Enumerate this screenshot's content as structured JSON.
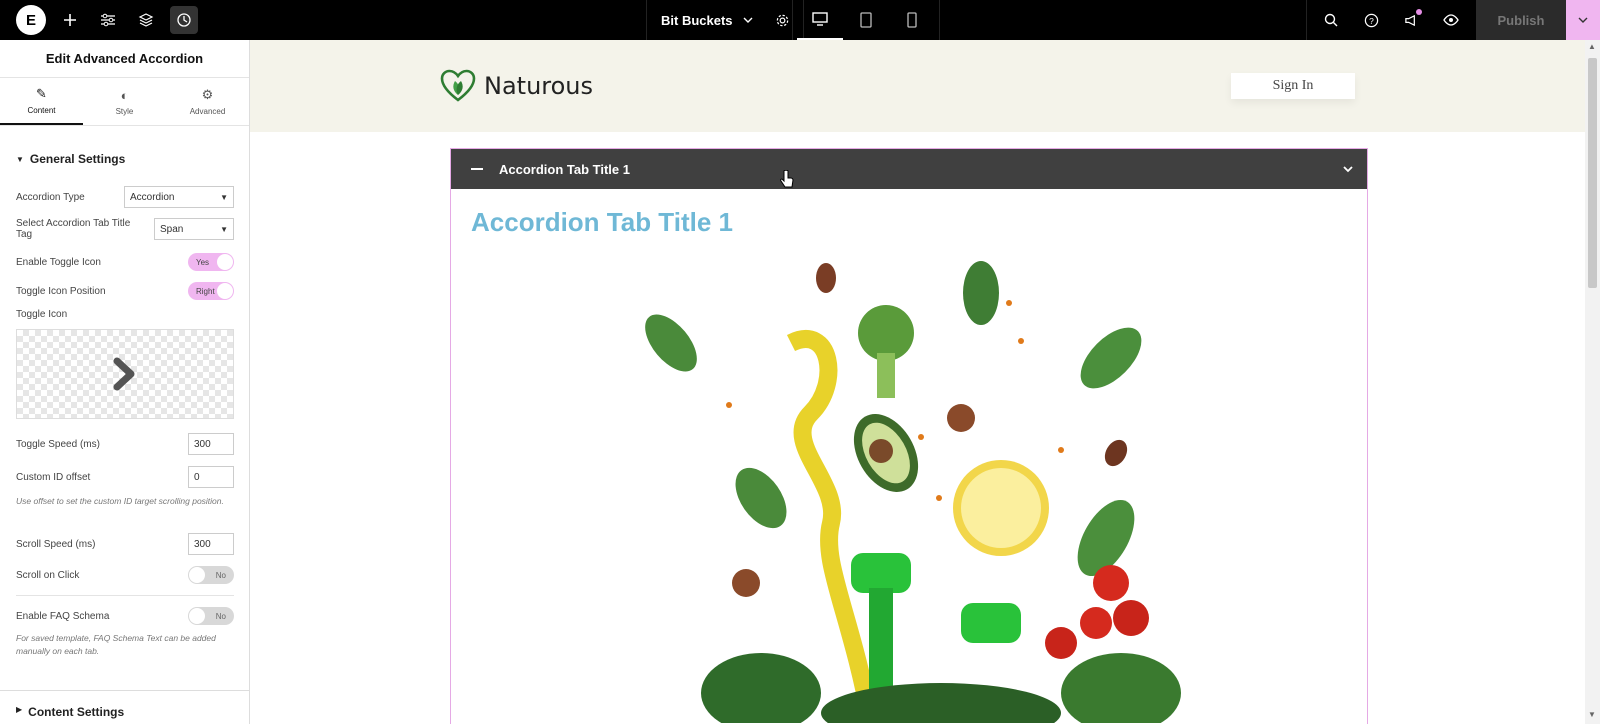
{
  "topbar": {
    "site_name": "Bit Buckets",
    "publish_label": "Publish"
  },
  "panel": {
    "title": "Edit Advanced Accordion",
    "tabs": [
      {
        "label": "Content"
      },
      {
        "label": "Style"
      },
      {
        "label": "Advanced"
      }
    ],
    "section_general": "General Settings",
    "accordion_type_label": "Accordion Type",
    "accordion_type_value": "Accordion",
    "title_tag_label": "Select Accordion Tab Title Tag",
    "title_tag_value": "Span",
    "enable_toggle_label": "Enable Toggle Icon",
    "enable_toggle_value": "Yes",
    "toggle_position_label": "Toggle Icon Position",
    "toggle_position_value": "Right",
    "toggle_icon_label": "Toggle Icon",
    "toggle_speed_label": "Toggle Speed (ms)",
    "toggle_speed_value": "300",
    "custom_id_label": "Custom ID offset",
    "custom_id_value": "0",
    "custom_id_help": "Use offset to set the custom ID target scrolling position.",
    "scroll_speed_label": "Scroll Speed (ms)",
    "scroll_speed_value": "300",
    "scroll_click_label": "Scroll on Click",
    "scroll_click_value": "No",
    "faq_label": "Enable FAQ Schema",
    "faq_value": "No",
    "faq_help": "For saved template, FAQ Schema Text can be added manually on each tab.",
    "section_content": "Content Settings"
  },
  "canvas": {
    "brand": "Naturous",
    "signin": "Sign In",
    "accordion_tab_title": "Accordion Tab Title 1",
    "accordion_content_title": "Accordion Tab Title 1"
  },
  "colors": {
    "accent_pink": "#f0b6f0",
    "accordion_header": "#404040",
    "content_title": "#6fb8d6",
    "brand_green": "#2e7d32"
  }
}
